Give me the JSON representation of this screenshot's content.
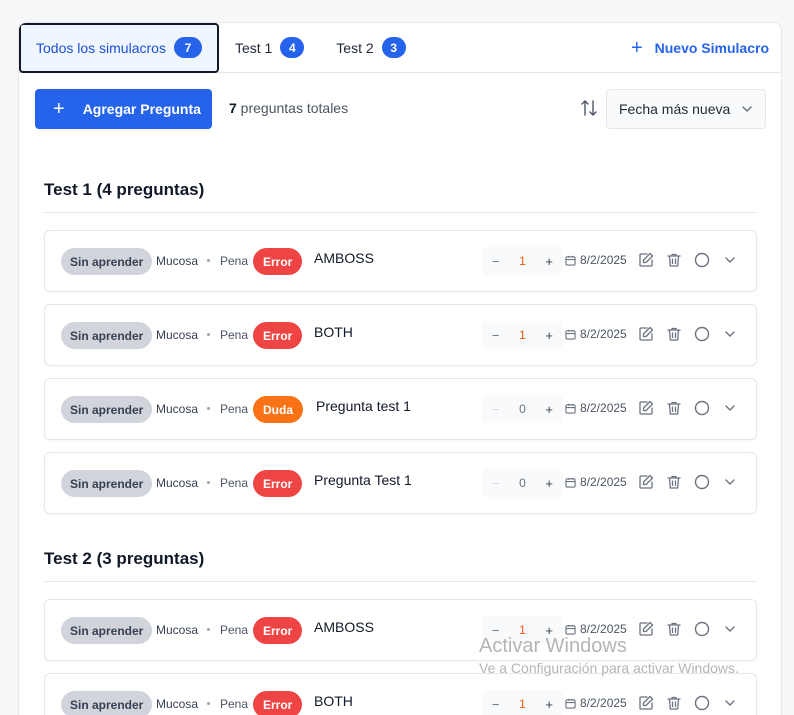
{
  "tabs": [
    {
      "label": "Todos los simulacros",
      "count": "7"
    },
    {
      "label": "Test 1",
      "count": "4"
    },
    {
      "label": "Test 2",
      "count": "3"
    }
  ],
  "new_simulation_label": "Nuevo Simulacro",
  "toolbar": {
    "add_label": "Agregar Pregunta",
    "total_count": "7",
    "total_suffix": " preguntas totales",
    "sort_value": "Fecha más nueva"
  },
  "groups": [
    {
      "title": "Test 1 (4 preguntas)",
      "questions": [
        {
          "status": "Sin aprender",
          "subject": "Mucosa",
          "topic": "Pena",
          "tag": "Error",
          "title": "AMBOSS",
          "count": "1",
          "date": "8/2/2025"
        },
        {
          "status": "Sin aprender",
          "subject": "Mucosa",
          "topic": "Pena",
          "tag": "Error",
          "title": "BOTH",
          "count": "1",
          "date": "8/2/2025"
        },
        {
          "status": "Sin aprender",
          "subject": "Mucosa",
          "topic": "Pena",
          "tag": "Duda",
          "title": "Pregunta test 1",
          "count": "0",
          "date": "8/2/2025"
        },
        {
          "status": "Sin aprender",
          "subject": "Mucosa",
          "topic": "Pena",
          "tag": "Error",
          "title": "Pregunta Test 1",
          "count": "0",
          "date": "8/2/2025"
        }
      ]
    },
    {
      "title": "Test 2 (3 preguntas)",
      "questions": [
        {
          "status": "Sin aprender",
          "subject": "Mucosa",
          "topic": "Pena",
          "tag": "Error",
          "title": "AMBOSS",
          "count": "1",
          "date": "8/2/2025"
        },
        {
          "status": "Sin aprender",
          "subject": "Mucosa",
          "topic": "Pena",
          "tag": "Error",
          "title": "BOTH",
          "count": "1",
          "date": "8/2/2025"
        }
      ]
    }
  ],
  "stepper_symbols": {
    "minus": "−",
    "plus": "+"
  },
  "watermark": {
    "line1": "Activar Windows",
    "line2": "Ve a Configuración para activar Windows."
  },
  "colors": {
    "accent": "#2563eb",
    "error": "#ef4444",
    "duda": "#f97316",
    "status_pill": "#d1d5db"
  },
  "icons": [
    "plus-icon",
    "sort-icon",
    "chevron-down-icon",
    "calendar-icon",
    "edit-icon",
    "trash-icon",
    "circle-icon"
  ]
}
